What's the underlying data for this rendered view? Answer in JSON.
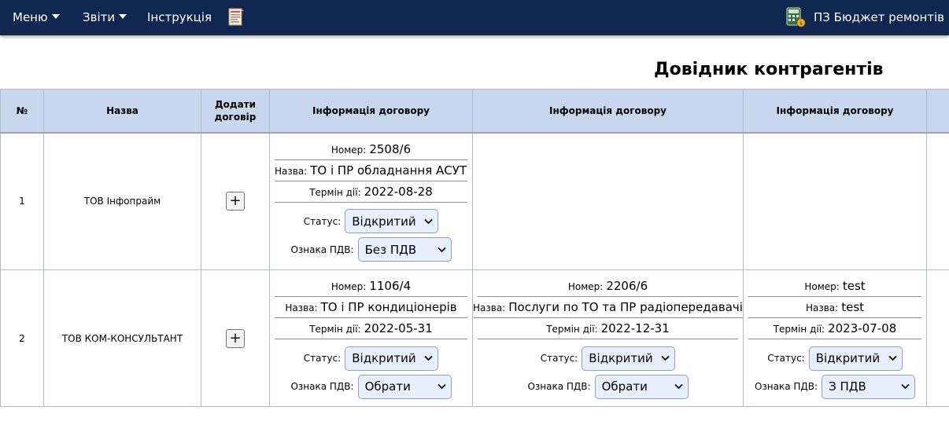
{
  "nav": {
    "menu": "Меню",
    "reports": "Звіти",
    "instructions": "Інструкція",
    "doc_icon": "document-report-icon",
    "app_icon": "calculator-budget-icon",
    "app_title": "ПЗ Бюджет ремонтів ІТ",
    "bar_color": "#0f2650"
  },
  "page_title": "Довідник контрагентів",
  "table": {
    "header_color": "#c8d7ee",
    "headers": {
      "num": "№",
      "name": "Назва",
      "add": "Додати договір",
      "info1": "Інформація договору",
      "info2": "Інформація договору",
      "info3": "Інформація договору"
    },
    "labels": {
      "number": "Номер:",
      "title": "Назва:",
      "term": "Термін дії:",
      "status": "Статус:",
      "vat": "Ознака ПДВ:"
    },
    "add_symbol": "+",
    "rows": [
      {
        "num": "1",
        "name": "ТОВ Інфопрайм",
        "contracts": [
          {
            "number": "2508/6",
            "title": "ТО і ПР обладнання АСУТП",
            "term": "2022-08-28",
            "status": "Відкритий",
            "vat": "Без ПДВ"
          }
        ]
      },
      {
        "num": "2",
        "name": "ТОВ КОМ-КОНСУЛЬТАНТ",
        "contracts": [
          {
            "number": "1106/4",
            "title": "ТО і ПР кондиціонерів",
            "term": "2022-05-31",
            "status": "Відкритий",
            "vat": "Обрати"
          },
          {
            "number": "2206/6",
            "title": "Послуги по ТО та ПР радіопередавачів",
            "term": "2022-12-31",
            "status": "Відкритий",
            "vat": "Обрати"
          },
          {
            "number": "test",
            "title": "test",
            "term": "2023-07-08",
            "status": "Відкритий",
            "vat": "З ПДВ"
          }
        ]
      }
    ]
  }
}
